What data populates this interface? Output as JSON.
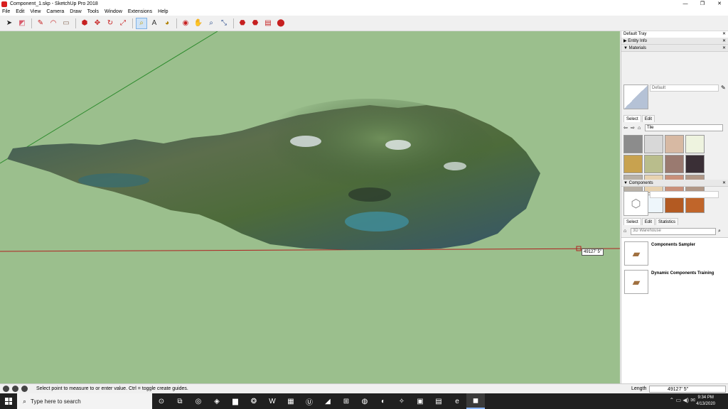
{
  "window": {
    "title": "Component_1.skp - SketchUp Pro 2018",
    "minimize": "—",
    "restore": "❐",
    "close": "✕"
  },
  "menu": [
    "File",
    "Edit",
    "View",
    "Camera",
    "Draw",
    "Tools",
    "Window",
    "Extensions",
    "Help"
  ],
  "toolbar": {
    "tools": [
      {
        "name": "select-tool",
        "glyph": "➤",
        "color": "#222222"
      },
      {
        "name": "eraser-tool",
        "glyph": "◩",
        "color": "#d85c6c"
      },
      {
        "name": "line-tool",
        "glyph": "✎",
        "color": "#c62020"
      },
      {
        "name": "arc-tool",
        "glyph": "◠",
        "color": "#c62020"
      },
      {
        "name": "shapes-tool",
        "glyph": "▭",
        "color": "#8a6d5a"
      },
      {
        "name": "push-pull-tool",
        "glyph": "⬢",
        "color": "#c62020"
      },
      {
        "name": "move-tool",
        "glyph": "✥",
        "color": "#c62020"
      },
      {
        "name": "rotate-tool",
        "glyph": "↻",
        "color": "#c62020"
      },
      {
        "name": "scale-tool",
        "glyph": "⤢",
        "color": "#c62020"
      },
      {
        "name": "tape-measure-tool",
        "glyph": "⌕",
        "color": "#c8a000"
      },
      {
        "name": "text-tool",
        "glyph": "A",
        "color": "#333333"
      },
      {
        "name": "paint-bucket-tool",
        "glyph": "◕",
        "color": "#b08000"
      },
      {
        "name": "orbit-tool",
        "glyph": "◉",
        "color": "#c62020"
      },
      {
        "name": "pan-tool",
        "glyph": "✋",
        "color": "#c8a000"
      },
      {
        "name": "zoom-tool",
        "glyph": "⌕",
        "color": "#2b4c8c"
      },
      {
        "name": "zoom-extents-tool",
        "glyph": "⤡",
        "color": "#2b4c8c"
      },
      {
        "name": "warehouse-tool",
        "glyph": "⬣",
        "color": "#c62020"
      },
      {
        "name": "extension-warehouse-tool",
        "glyph": "⬣",
        "color": "#c62020"
      },
      {
        "name": "layout-tool",
        "glyph": "▤",
        "color": "#c62020"
      },
      {
        "name": "extension-manager-tool",
        "glyph": "⬤",
        "color": "#c62020"
      }
    ]
  },
  "viewport": {
    "measure_tooltip": "49127' 5\"",
    "background": "#9bbf8d"
  },
  "tray": {
    "title": "Default Tray",
    "entity_info": "Entity Info",
    "materials": {
      "header": "Materials",
      "name": "Default",
      "tabs": [
        "Select",
        "Edit"
      ],
      "collection": "Tile",
      "swatches": [
        "#8c8c8c",
        "#d8d8d8",
        "#d7b9a3",
        "#eef3df",
        "#c8a24f",
        "#b9bd8c",
        "#9a7a70",
        "#3a2f36",
        "#b8b0a6",
        "#e7d2b0",
        "#c9907a",
        "#b09786",
        "#f4f4f0",
        "#eef6fb",
        "#b35a22",
        "#c0652a"
      ]
    },
    "components": {
      "header": "Components",
      "tabs": [
        "Select",
        "Edit",
        "Statistics"
      ],
      "search_placeholder": "3D Warehouse",
      "results": [
        "Components Sampler",
        "Dynamic Components Training"
      ]
    }
  },
  "status": {
    "message": "Select point to measure to or enter value.  Ctrl = toggle create guides.",
    "length_label": "Length",
    "length_value": "49127' 5\""
  },
  "taskbar": {
    "search_placeholder": "Type here to search",
    "apps": [
      "⊙",
      "⧉",
      "◎",
      "◈",
      "▆",
      "❂",
      "W",
      "▦",
      "Ⓤ",
      "◢",
      "⊞",
      "◍",
      "◐",
      "✧",
      "▣",
      "▤",
      "e",
      "◼"
    ],
    "tray_icons": "⌃ ▭ ◀) ✉",
    "time": "9:34 PM",
    "date": "4/13/2020"
  }
}
